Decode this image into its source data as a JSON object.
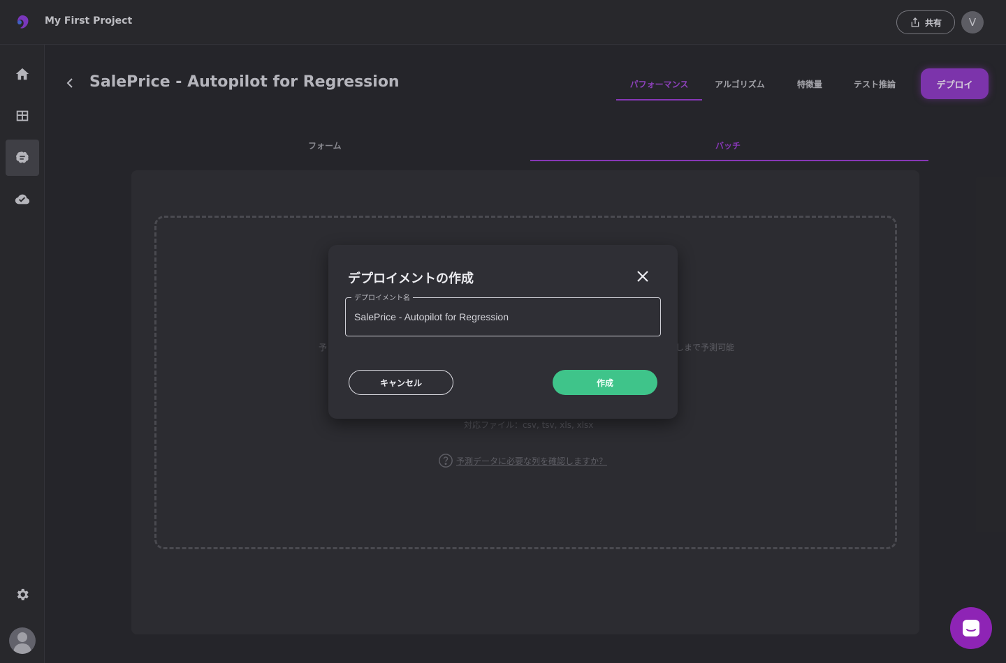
{
  "topbar": {
    "project_name": "My First Project",
    "share_label": "共有",
    "avatar_initial": "V"
  },
  "sidebar": {
    "items": [
      {
        "icon": "home-icon"
      },
      {
        "icon": "table-icon"
      },
      {
        "icon": "brain-icon",
        "active": true
      },
      {
        "icon": "cloud-check-icon"
      }
    ],
    "settings_icon": "gear-icon"
  },
  "header": {
    "title": "SalePrice - Autopilot for Regression",
    "tabs": [
      {
        "label": "パフォーマンス",
        "active": true
      },
      {
        "label": "アルゴリズム"
      },
      {
        "label": "特徴量"
      },
      {
        "label": "テスト推論"
      }
    ],
    "deploy_label": "デプロイ"
  },
  "subtabs": [
    {
      "label": "フォーム"
    },
    {
      "label": "バッチ",
      "active": true
    }
  ],
  "dropzone": {
    "note_left": "予",
    "note_right": "しまで予測可能",
    "file_types": "対応ファイル：csv, tsv, xls, xlsx",
    "help_link": "予測データに必要な列を確認しますか？"
  },
  "modal": {
    "title": "デプロイメントの作成",
    "field_label": "デプロイメント名",
    "field_value": "SalePrice - Autopilot for Regression",
    "cancel_label": "キャンセル",
    "create_label": "作成"
  },
  "colors": {
    "accent": "#9a3fd0",
    "create": "#3fc48a",
    "chat": "#8e24b5"
  }
}
